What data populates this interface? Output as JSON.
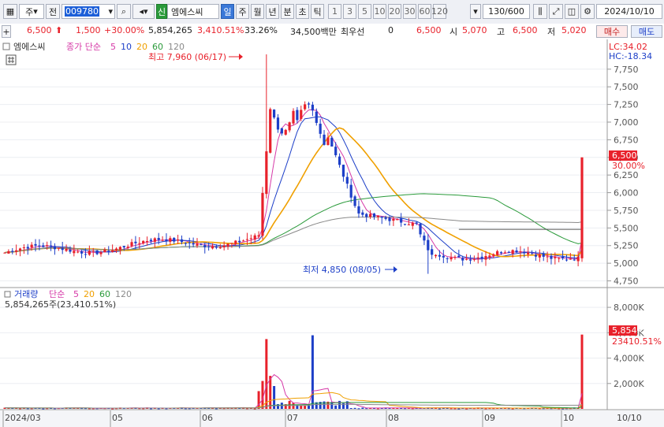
{
  "toolbar": {
    "market_label": "주",
    "prev_label": "전",
    "code": "009780",
    "name_badge": "신",
    "stock_name": "엠에스씨",
    "periods": [
      "일",
      "주",
      "월",
      "년",
      "분",
      "초",
      "틱"
    ],
    "minute_options": [
      "1",
      "3",
      "5",
      "10",
      "20",
      "30",
      "60",
      "120"
    ],
    "count": "130/600",
    "date": "2024/10/10"
  },
  "quote": {
    "price": "6,500",
    "change": "1,500",
    "change_pct": "+30.00%",
    "volume": "5,854,265",
    "volume_ratio": "3,410.51%",
    "turnover": "33.26%",
    "amount": "34,500백만",
    "broker_label": "최우선",
    "broker_value": "0",
    "last": "6,500",
    "open_label": "시",
    "open": "5,070",
    "high_label": "고",
    "high": "6,500",
    "low_label": "저",
    "low": "5,020",
    "buy_label": "매수",
    "sell_label": "매도"
  },
  "price_panel": {
    "name": "엠에스씨",
    "ma_caption": "종가 단순",
    "ma_periods": [
      "5",
      "10",
      "20",
      "60",
      "120"
    ],
    "lc": "LC:34.02",
    "hc": "HC:-18.34",
    "current_label": "6,500",
    "current_pct": "30.00%",
    "max_note": "최고 7,960 (06/17)",
    "min_note": "최저 4,850 (08/05)",
    "axis": [
      "7,750",
      "7,500",
      "7,250",
      "7,000",
      "6,750",
      "6,500",
      "6,250",
      "6,000",
      "5,750",
      "5,500",
      "5,250",
      "5,000",
      "4,750"
    ]
  },
  "volume_panel": {
    "title": "거래량",
    "ma_caption": "단순",
    "ma_periods": [
      "5",
      "20",
      "60",
      "120"
    ],
    "summary": "5,854,265주(23,410.51%)",
    "current_label": "5,854K",
    "current_pct": "23410.51%",
    "axis": [
      "8,000K",
      "6,000K",
      "4,000K",
      "2,000K"
    ]
  },
  "x_labels": [
    "2024/03",
    "05",
    "06",
    "07",
    "08",
    "09",
    "10",
    "10/10"
  ],
  "colors": {
    "up": "#e8212b",
    "down": "#1d3fc8",
    "ma5": "#d63aa8",
    "ma10": "#1d3fc8",
    "ma20": "#f0a000",
    "ma60": "#2a9a3a",
    "ma120": "#8a8a8a"
  },
  "chart_data": {
    "type": "candlestick",
    "title": "엠에스씨",
    "ylim": [
      4750,
      7960
    ],
    "volume_ylim": [
      0,
      8000
    ],
    "volume_unit": "K",
    "segments": [
      {
        "from": "2024/03",
        "to": "06/05",
        "price_range": [
          5100,
          5450
        ],
        "volume_approx_K": 80
      },
      {
        "from": "06/10",
        "to": "06/17",
        "high": 7960,
        "peak_volume_K": 5500
      },
      {
        "from": "06/18",
        "to": "07/01",
        "price_range": [
          6200,
          7600
        ]
      },
      {
        "from": "07/02",
        "to": "07/31",
        "price_range": [
          5500,
          6100
        ]
      },
      {
        "from": "08/05",
        "low": 4850
      },
      {
        "from": "08/06",
        "to": "10/07",
        "price_range": [
          5000,
          5350
        ]
      }
    ],
    "last": {
      "date": "10/10",
      "open": 5070,
      "high": 6500,
      "low": 5020,
      "close": 6500,
      "volume": 5854265
    }
  }
}
